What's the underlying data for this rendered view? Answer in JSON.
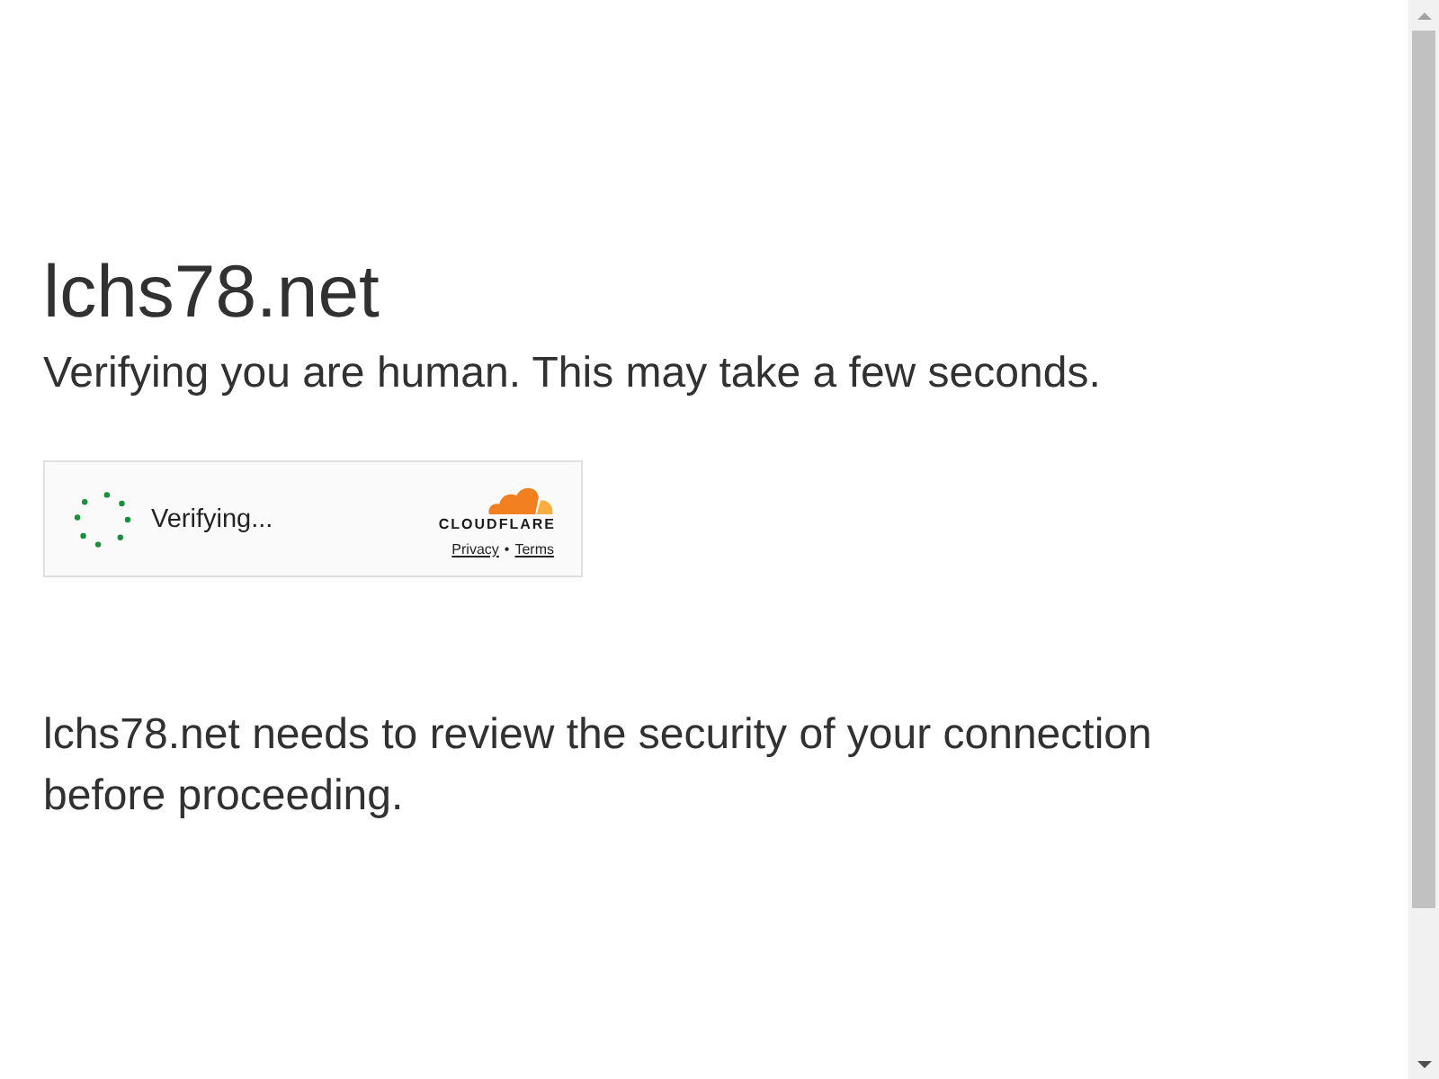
{
  "page": {
    "heading": "lchs78.net",
    "subtitle": "Verifying you are human. This may take a few seconds."
  },
  "challenge_widget": {
    "status": "Verifying...",
    "brand": "CLOUDFLARE",
    "links": [
      {
        "label": "Privacy"
      },
      {
        "label": "Terms"
      }
    ],
    "link_separator": "•"
  },
  "message": "lchs78.net needs to review the security of your connection before proceeding."
}
